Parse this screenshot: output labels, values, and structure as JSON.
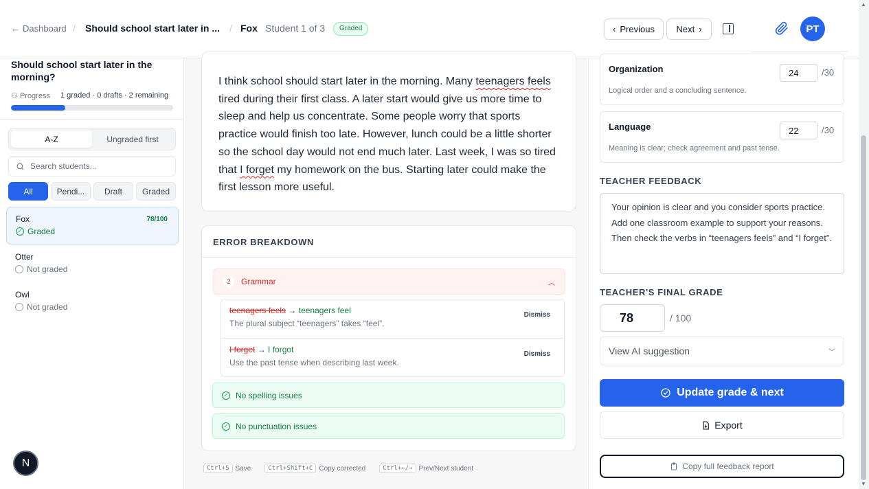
{
  "header": {
    "back_label": "Dashboard",
    "assignment_title": "Should school start later in ...",
    "student_name": "Fox",
    "student_position": "Student 1 of 3",
    "status_badge": "Graded",
    "prev_label": "Previous",
    "next_label": "Next",
    "avatar_initials": "PT"
  },
  "sidebar": {
    "title": "Should school start later in the morning?",
    "progress_label": "Progress",
    "progress_stats": "1 graded · 0 drafts · 2 remaining",
    "progress_fraction": 0.333,
    "sort_options": [
      "A-Z",
      "Ungraded first"
    ],
    "search_placeholder": "Search students...",
    "filters": [
      "All",
      "Pendi...",
      "Draft",
      "Graded"
    ],
    "students": [
      {
        "name": "Fox",
        "status": "Graded",
        "score": "78/100"
      },
      {
        "name": "Otter",
        "status": "Not graded"
      },
      {
        "name": "Owl",
        "status": "Not graded"
      }
    ],
    "fab_letter": "N"
  },
  "essay": {
    "p1": "I think school should start later in the morning. Many ",
    "err1": "teenagers feels",
    "p2": " tired during their first class. A later start would give us more time to sleep and help us concentrate. Some people worry that sports practice would finish too late. However, lunch could be a little shorter so the school day would not end much later. Last week, I was so tired that ",
    "err2": "I forget",
    "p3": " my homework on the bus. Starting later could make the first lesson more useful."
  },
  "errors": {
    "title": "ERROR BREAKDOWN",
    "grammar_count": "2",
    "grammar_label": "Grammar",
    "items": [
      {
        "wrong": "teenagers feels",
        "right": "teenagers feel",
        "note": "The plural subject “teenagers” takes “feel”.",
        "dismiss": "Dismiss"
      },
      {
        "wrong": "I forget",
        "right": "I forgot",
        "note": "Use the past tense when describing last week.",
        "dismiss": "Dismiss"
      }
    ],
    "spelling": "No spelling issues",
    "punctuation": "No punctuation issues"
  },
  "shortcuts": [
    {
      "key": "Ctrl+S",
      "label": "Save"
    },
    {
      "key": "Ctrl+Shift+C",
      "label": "Copy corrected"
    },
    {
      "key": "Ctrl+←/→",
      "label": "Prev/Next student"
    }
  ],
  "rubric": [
    {
      "name": "Organization",
      "desc": "Logical order and a concluding sentence.",
      "score": "24",
      "max": "/30"
    },
    {
      "name": "Language",
      "desc": "Meaning is clear; check agreement and past tense.",
      "score": "22",
      "max": "/30"
    }
  ],
  "feedback": {
    "label": "TEACHER FEEDBACK",
    "text": "Your opinion is clear and you consider sports practice. Add one classroom example to support your reasons. Then check the verbs in “teenagers feels” and “I forget”."
  },
  "grade": {
    "label": "TEACHER'S FINAL GRADE",
    "value": "78",
    "max": "/ 100",
    "ai_suggestion": "View AI suggestion"
  },
  "actions": {
    "primary": "Update grade & next",
    "export": "Export",
    "copy": "Copy full feedback report"
  }
}
